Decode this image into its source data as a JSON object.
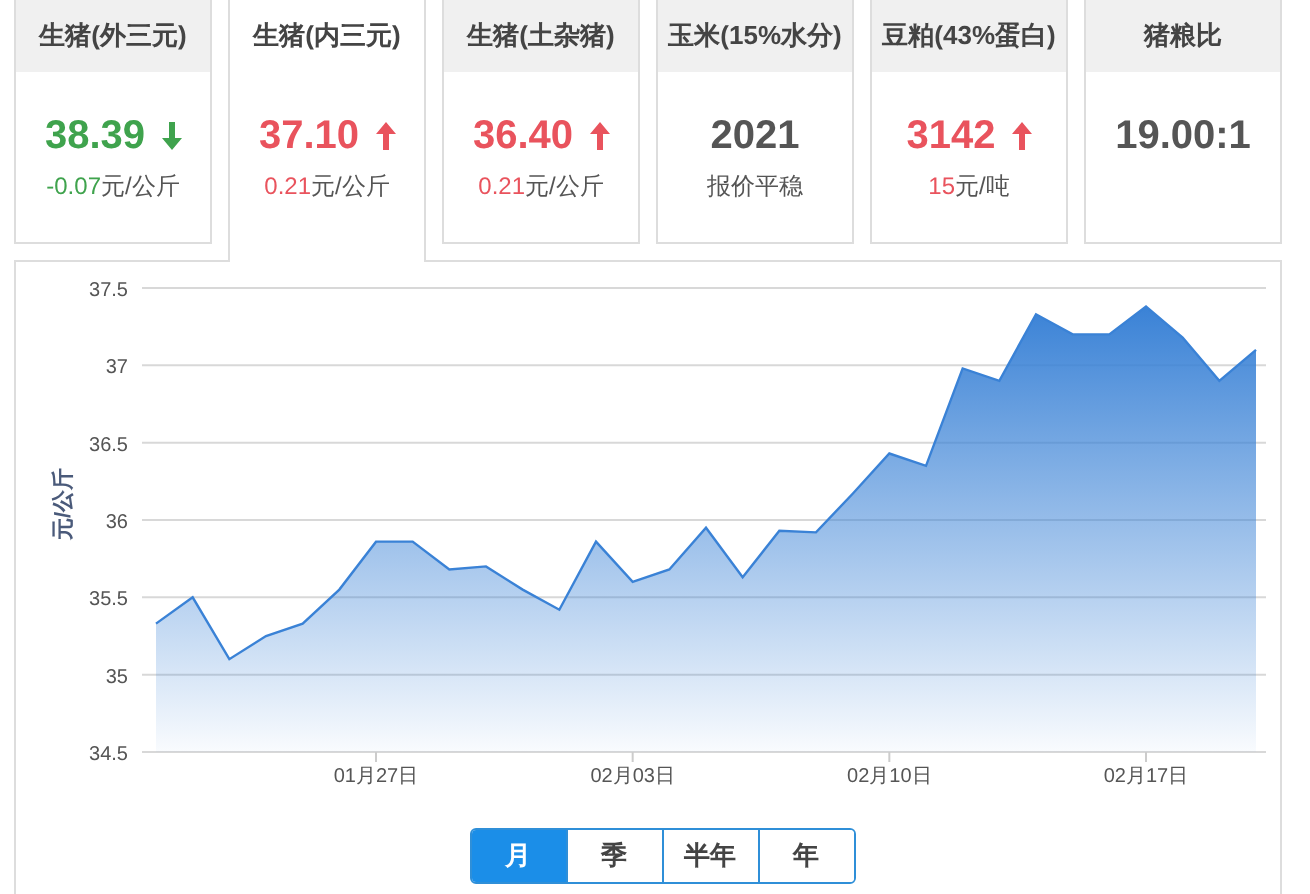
{
  "cards": [
    {
      "title": "生猪(外三元)",
      "selected": false,
      "value": "38.39",
      "kind": "down",
      "change": "-0.07",
      "unit": "元/公斤"
    },
    {
      "title": "生猪(内三元)",
      "selected": true,
      "value": "37.10",
      "kind": "up",
      "change": "0.21",
      "unit": "元/公斤"
    },
    {
      "title": "生猪(土杂猪)",
      "selected": false,
      "value": "36.40",
      "kind": "up",
      "change": "0.21",
      "unit": "元/公斤"
    },
    {
      "title": "玉米(15%水分)",
      "selected": false,
      "value": "2021",
      "kind": "flat",
      "note": "报价平稳"
    },
    {
      "title": "豆粕(43%蛋白)",
      "selected": false,
      "value": "3142",
      "kind": "up",
      "change": "15",
      "unit": "元/吨"
    },
    {
      "title": "猪粮比",
      "selected": false,
      "value": "19.00:1",
      "kind": "flat"
    }
  ],
  "chart": {
    "chart_data": {
      "type": "area",
      "ylabel": "元/公斤",
      "grid": true,
      "categories": [
        null,
        null,
        null,
        null,
        null,
        null,
        "01月27日",
        null,
        null,
        null,
        null,
        null,
        null,
        "02月03日",
        null,
        null,
        null,
        null,
        null,
        null,
        "02月10日",
        null,
        null,
        null,
        null,
        null,
        null,
        "02月17日",
        null,
        null,
        null
      ],
      "series": [
        {
          "color": "#3a82d6",
          "values": [
            35.33,
            35.5,
            35.1,
            35.25,
            35.33,
            35.55,
            35.86,
            35.86,
            35.68,
            35.7,
            35.55,
            35.42,
            35.86,
            35.6,
            35.68,
            35.95,
            35.63,
            35.93,
            35.92,
            36.17,
            36.43,
            36.35,
            36.98,
            36.9,
            37.33,
            37.2,
            37.2,
            37.38,
            37.18,
            36.9,
            37.1
          ]
        }
      ],
      "ylim": [
        34.5,
        37.5
      ],
      "yticks": [
        {
          "value": 34.5,
          "label": "34.5"
        },
        {
          "value": 35,
          "label": "35"
        },
        {
          "value": 35.5,
          "label": "35.5"
        },
        {
          "value": 36,
          "label": "36"
        },
        {
          "value": 36.5,
          "label": "36.5"
        },
        {
          "value": 37,
          "label": "37"
        },
        {
          "value": 37.5,
          "label": "37.5"
        }
      ]
    }
  },
  "periods": [
    {
      "label": "月",
      "selected": true
    },
    {
      "label": "季",
      "selected": false
    },
    {
      "label": "半年",
      "selected": false
    },
    {
      "label": "年",
      "selected": false
    }
  ]
}
